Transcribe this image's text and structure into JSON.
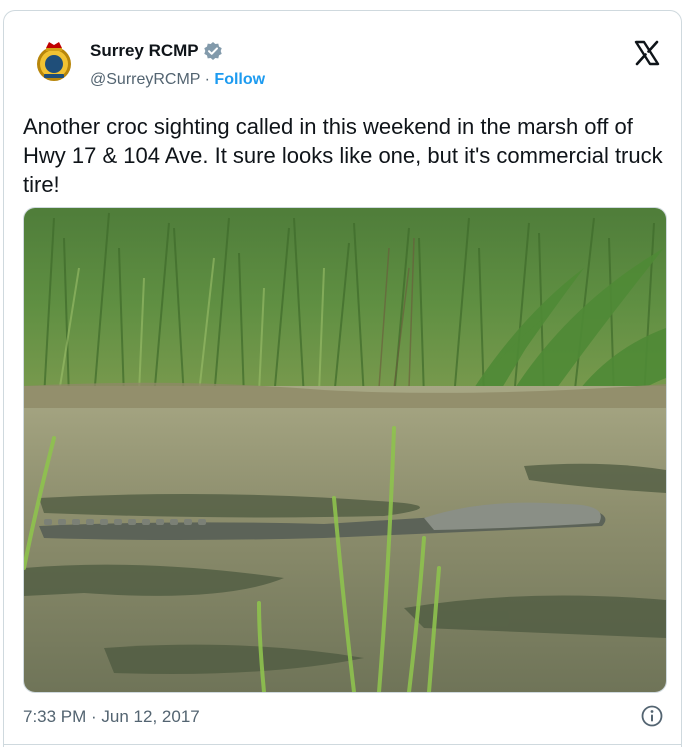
{
  "tweet": {
    "author_name": "Surrey RCMP",
    "handle": "@SurreyRCMP",
    "separator": "·",
    "follow_label": "Follow",
    "avatar_icon": "rcmp-badge-icon",
    "verified_icon": "verified-badge-icon",
    "platform_icon": "x-logo-icon",
    "text": "Another croc sighting called in this weekend in the marsh off of Hwy 17 & 104 Ave. It sure looks like one, but it's commercial truck tire!",
    "timestamp": "7:33 PM · Jun 12, 2017",
    "info_icon": "info-icon",
    "colors": {
      "accent": "#1d9bf0",
      "text": "#0f1419",
      "muted": "#536471",
      "border": "#cfd9de"
    }
  }
}
